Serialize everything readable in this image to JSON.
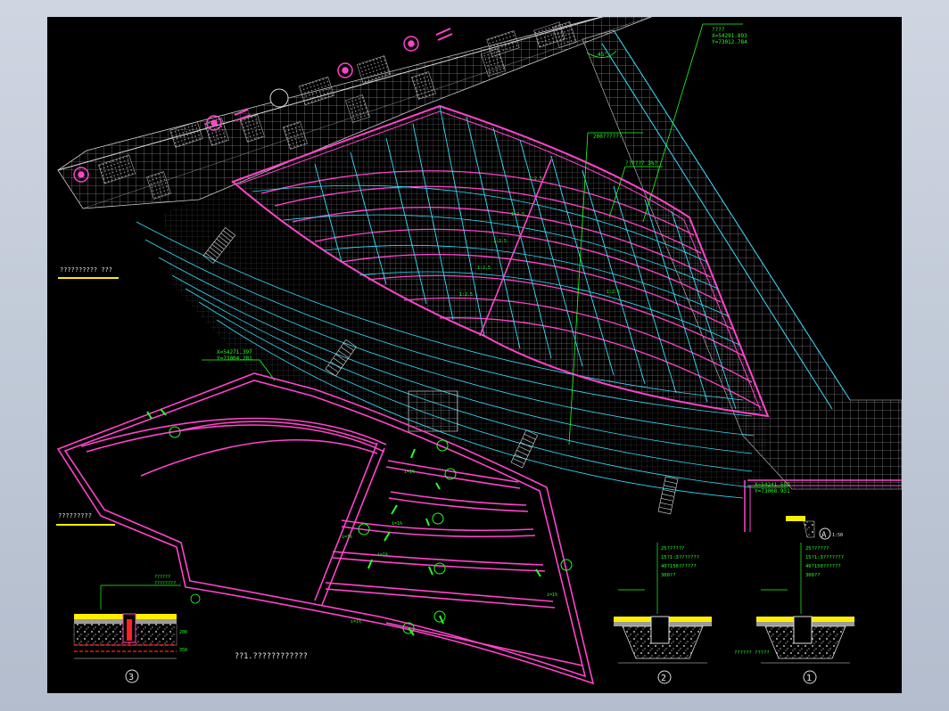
{
  "drawing": {
    "title_plan": "?????????? ???",
    "title_drain": "?????????",
    "note_bottom": "??1.????????????",
    "survey_label": "????",
    "top_coord_x": "X=54291.893",
    "top_coord_y": "Y=73012.784",
    "mid_coord_x": "X=54271.397",
    "mid_coord_y": "Y=73004.281",
    "right_coord_x": "X=54241.559",
    "right_coord_y": "Y=73008.931",
    "callout_a": "200??????",
    "callout_b": "?????? 3%?",
    "angle_label": "45°",
    "detail_1": "1",
    "detail_2": "2",
    "detail_3": "3",
    "detail_a": "A",
    "layers_1": [
      "25??????",
      "15?1:3???????",
      "40?150??????",
      "300??"
    ],
    "layers_2": [
      "25??????",
      "15?1:3???????",
      "40?150??????",
      "300??"
    ],
    "layers_3": [
      "??????",
      "????????"
    ],
    "base_label": "?????? ?????",
    "dim_small": "200",
    "dim_mid": "350",
    "scale_note": "1:50"
  }
}
